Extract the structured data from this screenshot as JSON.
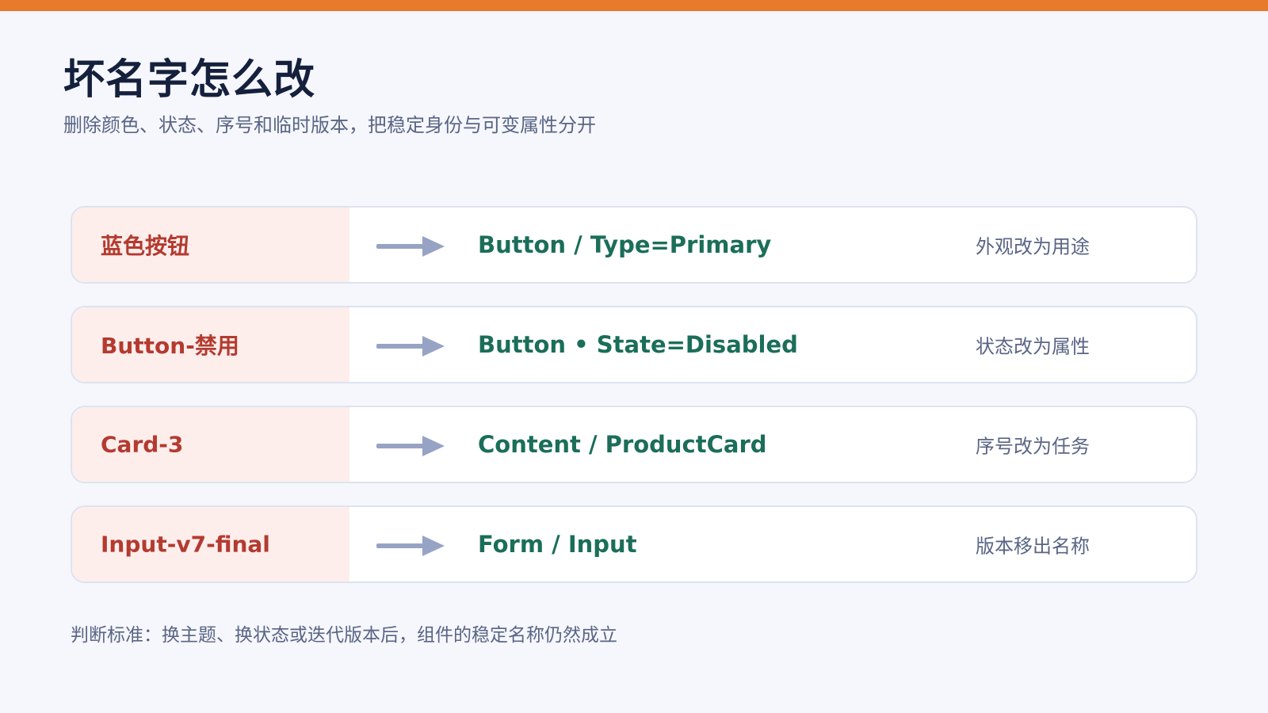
{
  "title": "坏名字怎么改",
  "subtitle": "删除颜色、状态、序号和临时版本，把稳定身份与可变属性分开",
  "rows": [
    {
      "old": "蓝色按钮",
      "new": "Button / Type=Primary",
      "note": "外观改为用途"
    },
    {
      "old": "Button-禁用",
      "new": "Button • State=Disabled",
      "note": "状态改为属性"
    },
    {
      "old": "Card-3",
      "new": "Content / ProductCard",
      "note": "序号改为任务"
    },
    {
      "old": "Input-v7-final",
      "new": "Form / Input",
      "note": "版本移出名称"
    }
  ],
  "footer": "判断标准：换主题、换状态或迭代版本后，组件的稳定名称仍然成立",
  "colors": {
    "accent": "#e87a2e",
    "title": "#15203d",
    "old_name": "#b43a2f",
    "old_bg": "#fdeeec",
    "new_name": "#1b6e59",
    "arrow": "#97a3c4"
  }
}
